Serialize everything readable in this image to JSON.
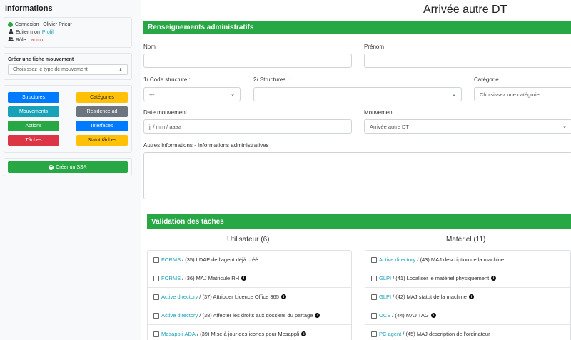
{
  "sidebar": {
    "title": "Informations",
    "connexion": "Connexion : Olivier Prieur",
    "edit_prefix": "Editer mon ",
    "edit_link": "Profil",
    "role_prefix": "Rôle : ",
    "role_value": "admin",
    "create_label": "Créer une fiche mouvement",
    "create_select": "Choisissez le type de mouvement",
    "buttons": [
      {
        "label": "Structures",
        "color": "#007bff"
      },
      {
        "label": "Catégories",
        "color": "#ffc107"
      },
      {
        "label": "Mouvements",
        "color": "#17a2b8"
      },
      {
        "label": "Residence ad",
        "color": "#6c757d"
      },
      {
        "label": "Actions",
        "color": "#28a745"
      },
      {
        "label": "Interfaces",
        "color": "#007bff"
      },
      {
        "label": "Tâches",
        "color": "#dc3545"
      },
      {
        "label": "Statut tâches",
        "color": "#ffc107"
      }
    ],
    "ssr_button": "Créer un SSR"
  },
  "main": {
    "title": "Arrivée autre DT",
    "section_admin": "Renseignements administratifs",
    "nom_label": "Nom",
    "prenom_label": "Prénom",
    "code_label": "1/ Code structure :",
    "code_value": "---",
    "structures_label": "2/ Structures :",
    "categorie_label": "Catégorie",
    "categorie_value": "Choisissez une catégorie",
    "date_label": "Date mouvement",
    "date_placeholder": "jj / mm / aaaa",
    "mouvement_label": "Mouvement",
    "mouvement_value": "Arrivée autre DT",
    "autres_label": "Autres informations - Informations administratives",
    "section_tasks": "Validation des tâches",
    "user_col_title": "Utilisateur (6)",
    "mat_col_title": "Matériel (11)",
    "user_tasks": [
      {
        "link": "FORMS",
        "text": "/ (35) LDAP de l'agent déjà créé",
        "info": false
      },
      {
        "link": "FORMS",
        "text": "/ (36) MAJ Matricule RH",
        "info": true
      },
      {
        "link": "Active directory",
        "text": "/ (37) Attribuer Licence Office 365",
        "info": true
      },
      {
        "link": "Active directory",
        "text": "/ (38) Affecter les droits aux dossiers du partage",
        "info": true
      },
      {
        "link": "Mesappli-ADA",
        "text": "/ (39) Mise à jour des icones pour Mesappli",
        "info": true
      }
    ],
    "mat_tasks": [
      {
        "link": "Active directory",
        "text": "/ (43) MAJ description de la machine",
        "info": false
      },
      {
        "link": "GLPI",
        "text": "/ (41) Localiser le matériel physiquement",
        "info": true
      },
      {
        "link": "GLPI",
        "text": "/ (42) MAJ statut de la machine",
        "info": true
      },
      {
        "link": "OCS",
        "text": "/ (44) MAJ TAG",
        "info": true
      },
      {
        "link": "PC agent",
        "text": "/ (45) MAJ description de l'ordinateur",
        "info": false
      }
    ]
  }
}
